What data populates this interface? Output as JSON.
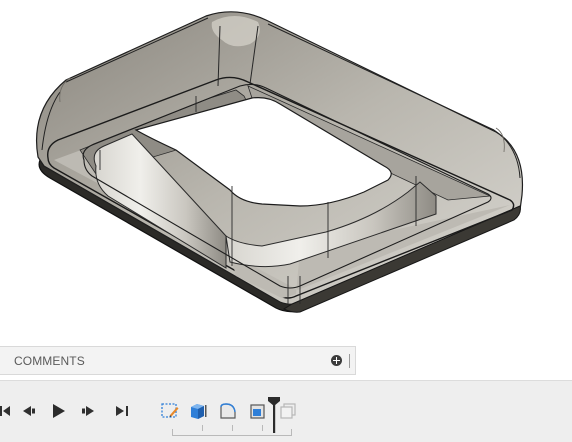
{
  "comments_panel": {
    "label": "COMMENTS",
    "add_icon": "plus-circle-icon"
  },
  "timeline": {
    "controls": [
      {
        "name": "go-to-start",
        "icon": "skip-start-icon"
      },
      {
        "name": "step-back",
        "icon": "step-back-icon"
      },
      {
        "name": "play",
        "icon": "play-icon"
      },
      {
        "name": "step-forward",
        "icon": "step-forward-icon"
      },
      {
        "name": "go-to-end",
        "icon": "skip-end-icon"
      }
    ],
    "features": [
      {
        "name": "sketch",
        "icon": "sketch-icon"
      },
      {
        "name": "extrude",
        "icon": "extrude-icon"
      },
      {
        "name": "fillet",
        "icon": "fillet-icon"
      },
      {
        "name": "shell",
        "icon": "shell-icon"
      },
      {
        "name": "suppressed-feature",
        "icon": "ghost-body-icon"
      }
    ]
  },
  "colors": {
    "model_face": "#c2c0b8",
    "model_edge": "#1e1e1e",
    "timeline_accent": "#2f7fd8"
  }
}
